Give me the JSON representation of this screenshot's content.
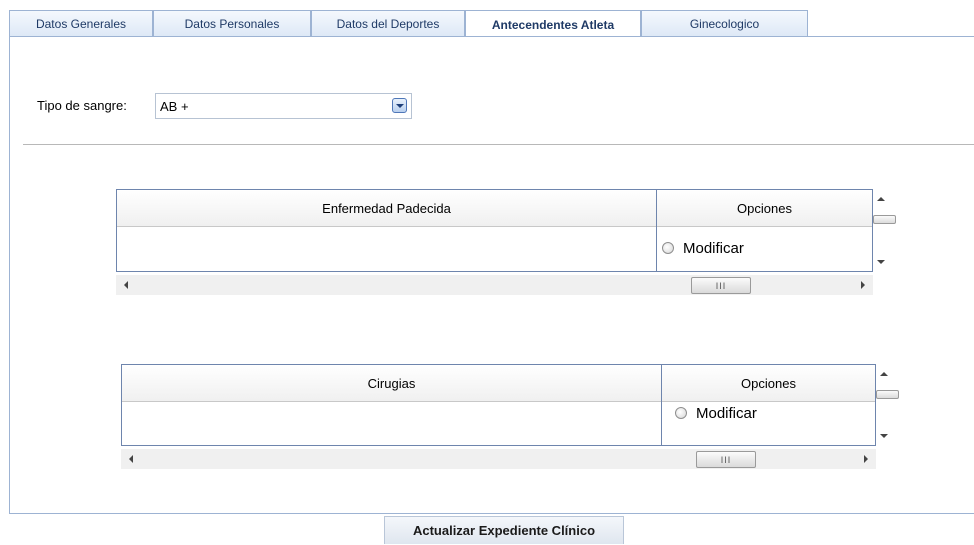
{
  "tabs": [
    {
      "label": "Datos Generales"
    },
    {
      "label": "Datos Personales"
    },
    {
      "label": "Datos del Deportes"
    },
    {
      "label": "Antecendentes Atleta"
    },
    {
      "label": "Ginecologico"
    }
  ],
  "active_tab": "Antecendentes Atleta",
  "blood_type": {
    "label": "Tipo de sangre:",
    "value": "AB +"
  },
  "grid_illness": {
    "col_main": "Enfermedad Padecida",
    "col_options": "Opciones",
    "rows": [
      {
        "main": "",
        "option": "Modificar"
      }
    ],
    "hscroll_grip": "III"
  },
  "grid_surgery": {
    "col_main": "Cirugias",
    "col_options": "Opciones",
    "rows": [
      {
        "main": "",
        "option": "Modificar"
      }
    ],
    "hscroll_grip": "III"
  },
  "update_button": "Actualizar Expediente Clínico",
  "colors": {
    "accent_border": "#9db3d3",
    "tab_text": "#1f3a66",
    "grid_border": "#6e85ad"
  },
  "icons": [
    "chevron-down-icon",
    "scroll-up-icon",
    "scroll-down-icon",
    "scroll-left-icon",
    "scroll-right-icon",
    "radio-icon"
  ]
}
